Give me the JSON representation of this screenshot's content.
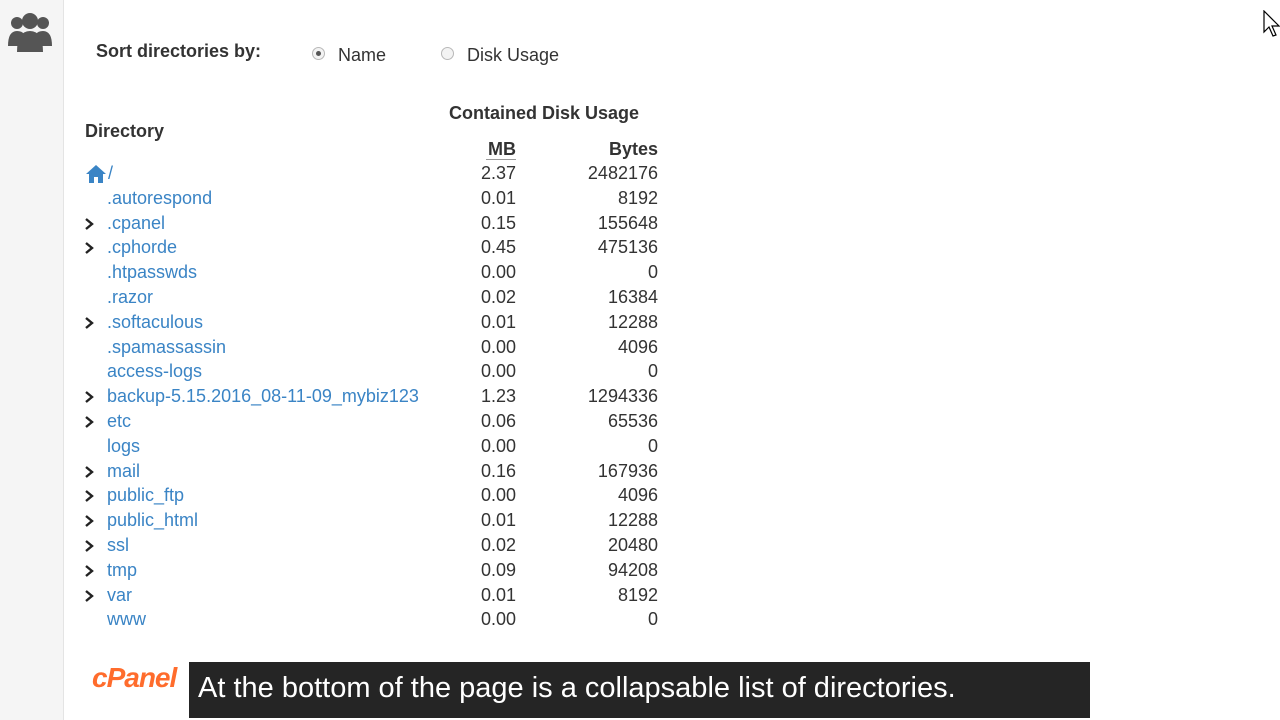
{
  "sort": {
    "label": "Sort directories by:",
    "options": [
      {
        "label": "Name",
        "selected": true
      },
      {
        "label": "Disk Usage",
        "selected": false
      }
    ]
  },
  "table": {
    "col_directory": "Directory",
    "col_group": "Contained Disk Usage",
    "col_mb": "MB",
    "col_bytes": "Bytes",
    "root": {
      "name": "/",
      "mb": "2.37",
      "bytes": "2482176",
      "icon": "home-icon"
    },
    "rows": [
      {
        "name": ".autorespond",
        "mb": "0.01",
        "bytes": "8192",
        "expandable": false
      },
      {
        "name": ".cpanel",
        "mb": "0.15",
        "bytes": "155648",
        "expandable": true
      },
      {
        "name": ".cphorde",
        "mb": "0.45",
        "bytes": "475136",
        "expandable": true
      },
      {
        "name": ".htpasswds",
        "mb": "0.00",
        "bytes": "0",
        "expandable": false
      },
      {
        "name": ".razor",
        "mb": "0.02",
        "bytes": "16384",
        "expandable": false
      },
      {
        "name": ".softaculous",
        "mb": "0.01",
        "bytes": "12288",
        "expandable": true
      },
      {
        "name": ".spamassassin",
        "mb": "0.00",
        "bytes": "4096",
        "expandable": false
      },
      {
        "name": "access-logs",
        "mb": "0.00",
        "bytes": "0",
        "expandable": false
      },
      {
        "name": "backup-5.15.2016_08-11-09_mybiz123",
        "mb": "1.23",
        "bytes": "1294336",
        "expandable": true
      },
      {
        "name": "etc",
        "mb": "0.06",
        "bytes": "65536",
        "expandable": true
      },
      {
        "name": "logs",
        "mb": "0.00",
        "bytes": "0",
        "expandable": false
      },
      {
        "name": "mail",
        "mb": "0.16",
        "bytes": "167936",
        "expandable": true
      },
      {
        "name": "public_ftp",
        "mb": "0.00",
        "bytes": "4096",
        "expandable": true
      },
      {
        "name": "public_html",
        "mb": "0.01",
        "bytes": "12288",
        "expandable": true
      },
      {
        "name": "ssl",
        "mb": "0.02",
        "bytes": "20480",
        "expandable": true
      },
      {
        "name": "tmp",
        "mb": "0.09",
        "bytes": "94208",
        "expandable": true
      },
      {
        "name": "var",
        "mb": "0.01",
        "bytes": "8192",
        "expandable": true
      },
      {
        "name": "www",
        "mb": "0.00",
        "bytes": "0",
        "expandable": false
      }
    ]
  },
  "footer": {
    "logo_text": "cPanel"
  },
  "caption": "At the bottom of the page is a collapsable list of directories.",
  "colors": {
    "link": "#3a84c5",
    "logo": "#ff6c2c",
    "caption_bg": "#141414"
  },
  "icons": {
    "sidebar": "users-icon",
    "expand": "chevron-right-icon",
    "pointer": "mouse-cursor-icon"
  }
}
